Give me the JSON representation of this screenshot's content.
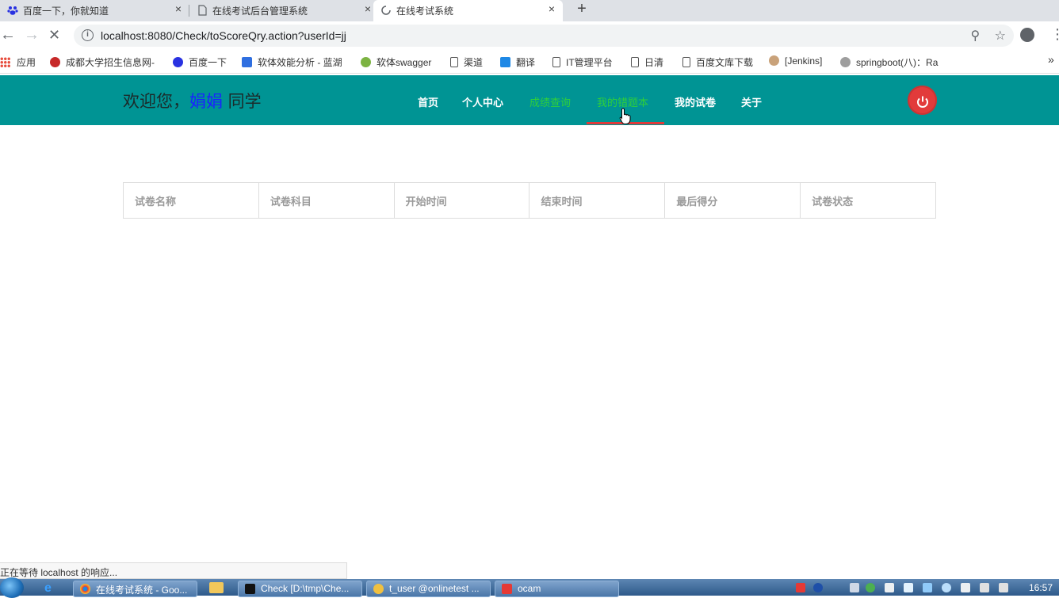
{
  "browser": {
    "tabs": [
      {
        "title": "百度一下，你就知道",
        "close": "×"
      },
      {
        "title": "在线考试后台管理系统",
        "close": "×"
      },
      {
        "title": "在线考试系统",
        "close": "×"
      }
    ],
    "new_tab": "+",
    "url": "localhost:8080/Check/toScoreQry.action?userId=jj",
    "bookmarks": [
      "应用",
      "成都大学招生信息网-",
      "百度一下",
      "软体效能分析 - 蓝湖",
      "软体swagger",
      "渠道",
      "翻译",
      "IT管理平台",
      "日清",
      "百度文库下载",
      "[Jenkins]",
      "springboot(八)：Ra"
    ],
    "more_bookmarks": "»",
    "status_text": "正在等待 localhost 的响应..."
  },
  "site": {
    "welcome_prefix": "欢迎您，",
    "user_name": "娟娟",
    "welcome_suffix": " 同学",
    "nav": [
      "首页",
      "个人中心",
      "成绩查询",
      "我的错题本",
      "我的试卷",
      "关于"
    ],
    "table_headers": [
      "试卷名称",
      "试卷科目",
      "开始时间",
      "结束时间",
      "最后得分",
      "试卷状态"
    ]
  },
  "taskbar": {
    "items": [
      "在线考试系统 - Goo...",
      "Check [D:\\tmp\\Che...",
      "t_user @onlinetest ...",
      "ocam"
    ],
    "clock": "16:57"
  },
  "colors": {
    "header_bg": "#009494",
    "nav_active": "#2fd03a",
    "user_name": "#1a22ff",
    "underline": "#e03a3a",
    "power_button": "#e23b3b"
  }
}
